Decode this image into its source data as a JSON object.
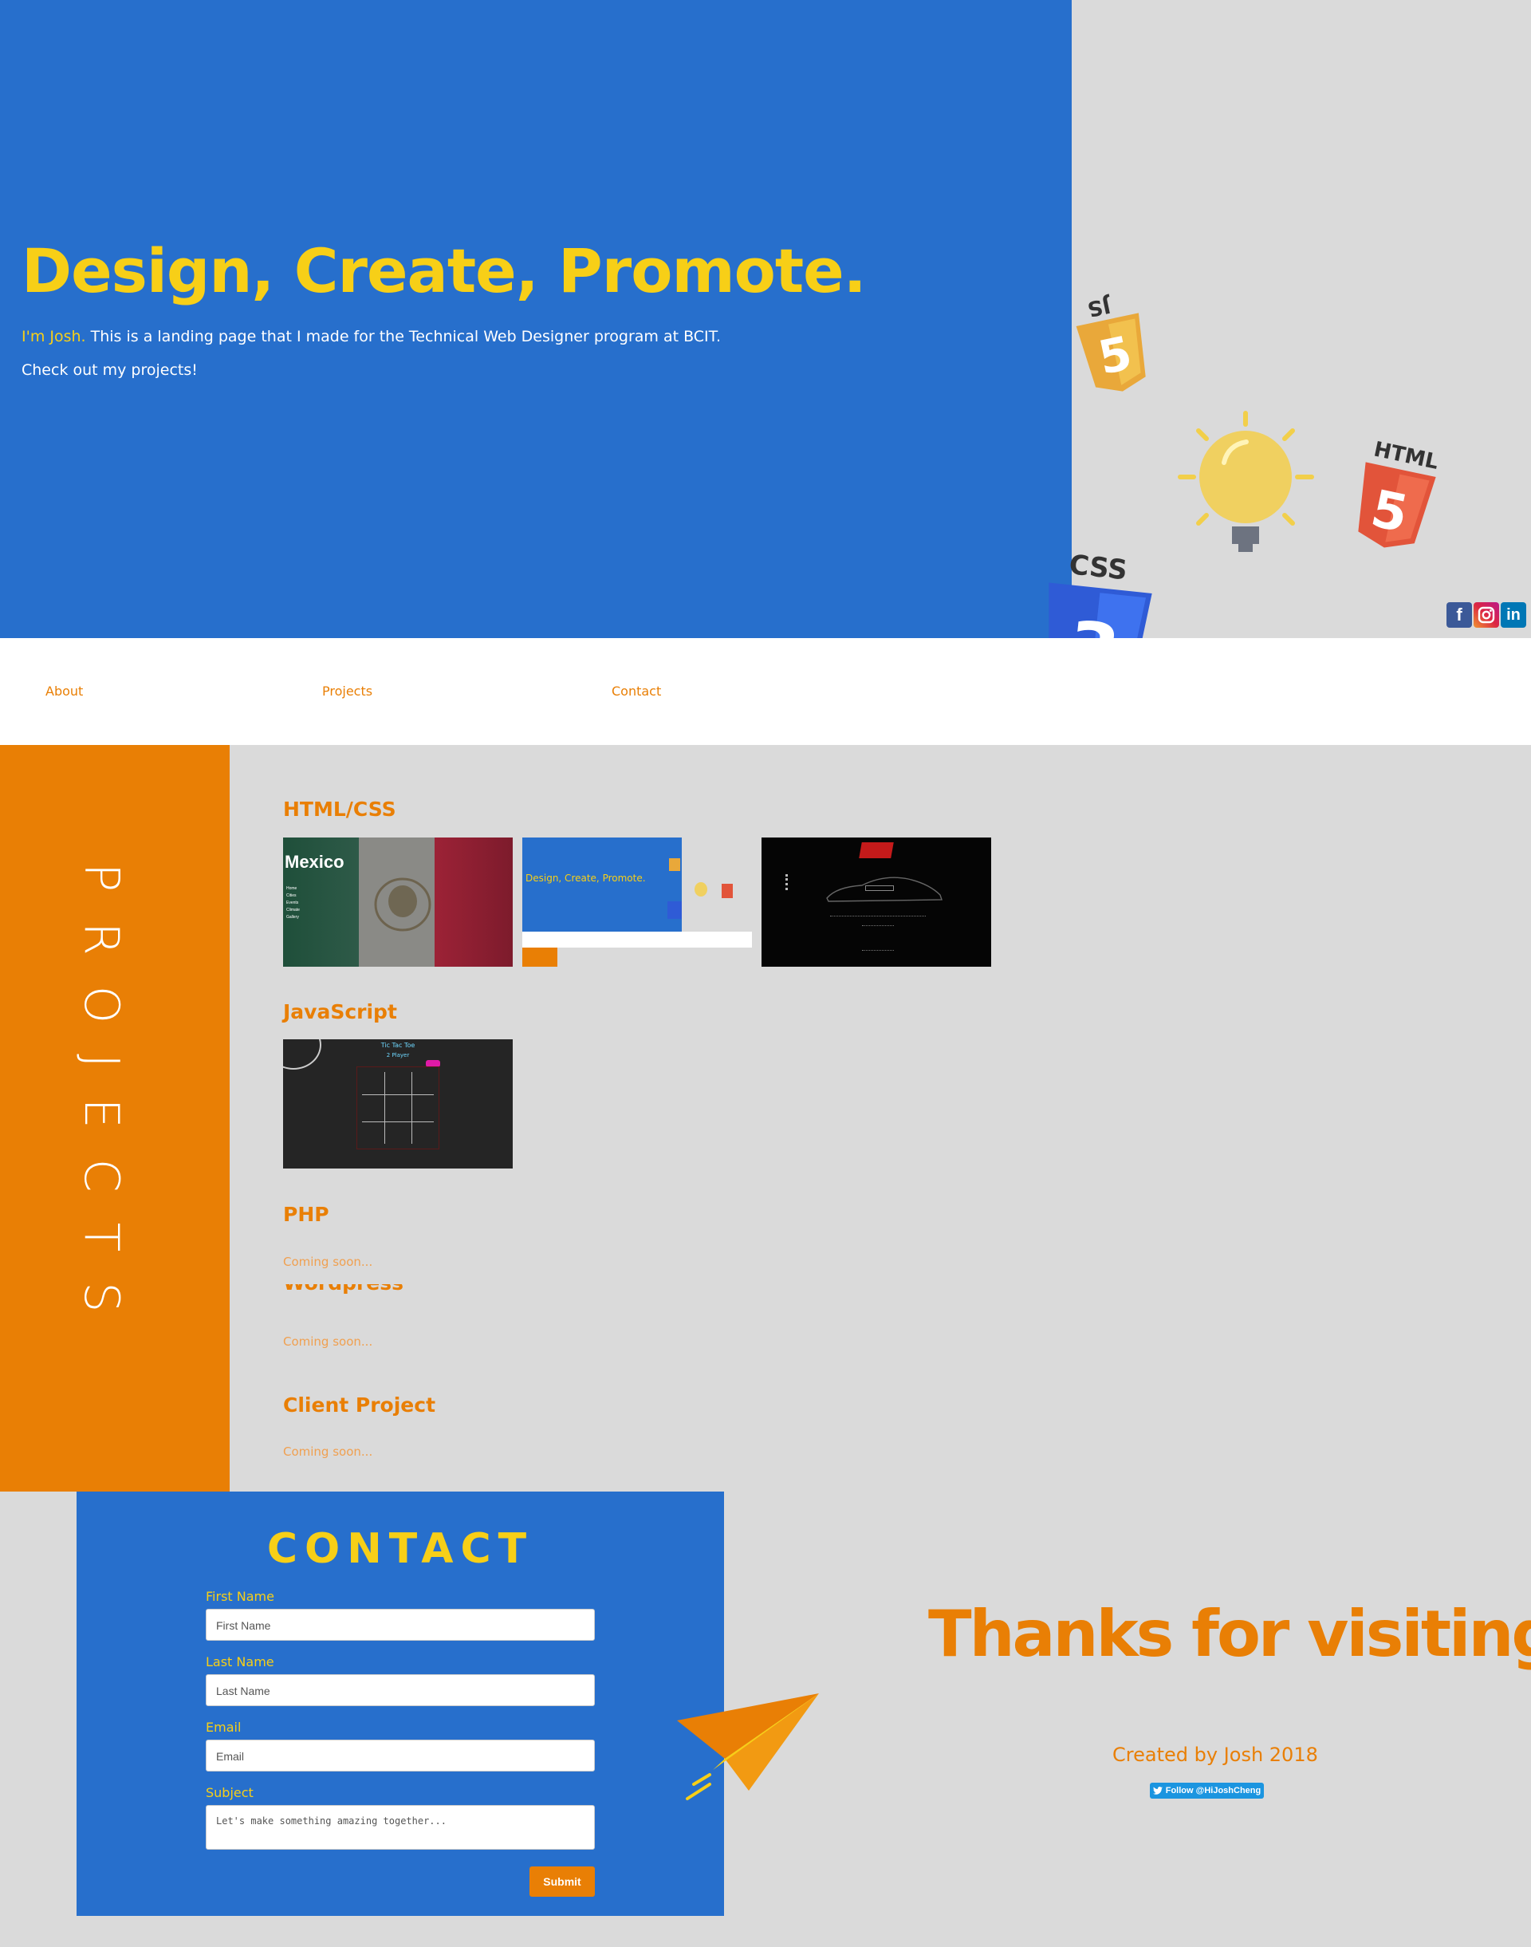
{
  "hero": {
    "title": "Design, Create, Promote.",
    "intro_name": "I'm Josh.",
    "intro_text": " This is a landing page that I made for the Technical Web Designer program at BCIT.",
    "cta": "Check out my projects!",
    "badges": {
      "js": "JS",
      "html": "HTML",
      "css": "CSS"
    },
    "social": [
      "facebook-icon",
      "instagram-icon",
      "linkedin-icon"
    ],
    "colors": {
      "blue": "#276fcc",
      "yellow": "#f7cf17",
      "orange": "#e97f05"
    }
  },
  "nav": {
    "about": "About",
    "projects": "Projects",
    "contact": "Contact"
  },
  "projects": {
    "side_title": "PROJECTS",
    "categories": {
      "htmlcss": "HTML/CSS",
      "javascript": "JavaScript",
      "php": "PHP",
      "wordpress": "Wordpress",
      "client": "Client Project"
    },
    "coming_soon": "Coming soon...",
    "thumbs": {
      "mexico_title": "Mexico",
      "mexico_menu": [
        "Home",
        "Cities",
        "Events",
        "Climate",
        "Gallery"
      ],
      "landing_title": "Design, Create, Promote.",
      "ttt_title": "Tic Tac Toe",
      "ttt_sub": "2 Player"
    }
  },
  "contact": {
    "title": "CONTACT",
    "first_label": "First Name",
    "first_placeholder": "First Name",
    "last_label": "Last Name",
    "last_placeholder": "Last Name",
    "email_label": "Email",
    "email_placeholder": "Email",
    "subject_label": "Subject",
    "subject_placeholder": "Let's make something amazing together...",
    "submit": "Submit"
  },
  "footer": {
    "thanks": "Thanks for visiting..",
    "created": "Created by Josh 2018",
    "follow": "Follow @HiJoshCheng"
  }
}
